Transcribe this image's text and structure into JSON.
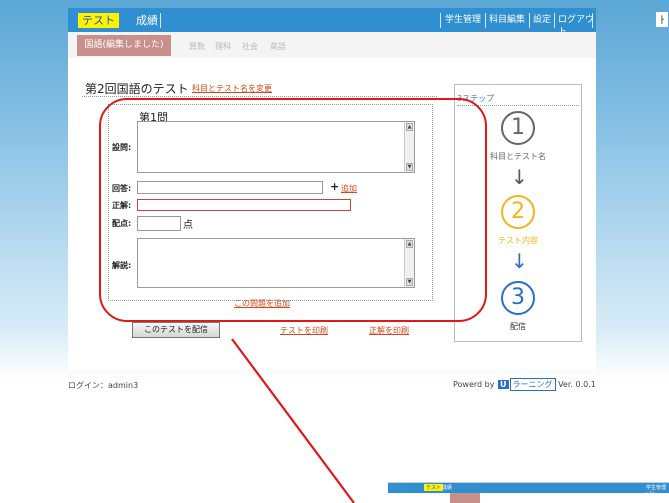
{
  "header": {
    "tab_test": "テスト",
    "tab_grade": "成績",
    "nav": [
      "学生管理",
      "科目編集",
      "設定",
      "ログアウト"
    ]
  },
  "subjects": {
    "active": "国語(編集しました)",
    "others": [
      "算数",
      "理科",
      "社会",
      "英語"
    ]
  },
  "editor": {
    "title": "第2回国語のテスト",
    "change_link": "科目とテスト名を変更",
    "question_number": "第1問",
    "label_question": "設問:",
    "label_answer": "回答:",
    "plus": "+",
    "add_link": "追加",
    "label_correct": "正解:",
    "label_points": "配点:",
    "points_unit": "点",
    "label_explanation": "解説:",
    "add_question": "この問題を追加",
    "distribute_button": "このテストを配信",
    "print_test": "テストを印刷",
    "print_answers": "正解を印刷"
  },
  "steps": {
    "title": "3ステップ",
    "items": [
      {
        "number": "1",
        "label": "科目とテスト名",
        "color": "#666666"
      },
      {
        "number": "2",
        "label": "テスト内容",
        "color": "#f2b51d"
      },
      {
        "number": "3",
        "label": "配信",
        "color": "#2a6ec9"
      }
    ],
    "arrows": [
      "↓",
      "↓"
    ]
  },
  "footer": {
    "login": "ログイン：admin3",
    "powered_prefix": "Powerd by",
    "logo_letter": "U",
    "logo_text": "ラーニング",
    "version": "Ver. 0.0.1"
  },
  "thumbnail": {
    "tab_test": "テスト",
    "tab_grade": "成績",
    "nav_fragment": "学生管理 | 科"
  },
  "edge_glyph": "ㅏ",
  "colors": {
    "header_blue": "#2f8fd0",
    "active_subject": "#c8908a",
    "link_orange": "#d24a1a",
    "highlight_red": "#e01818",
    "step_current": "#f2b51d",
    "step_next": "#2a6ec9"
  }
}
